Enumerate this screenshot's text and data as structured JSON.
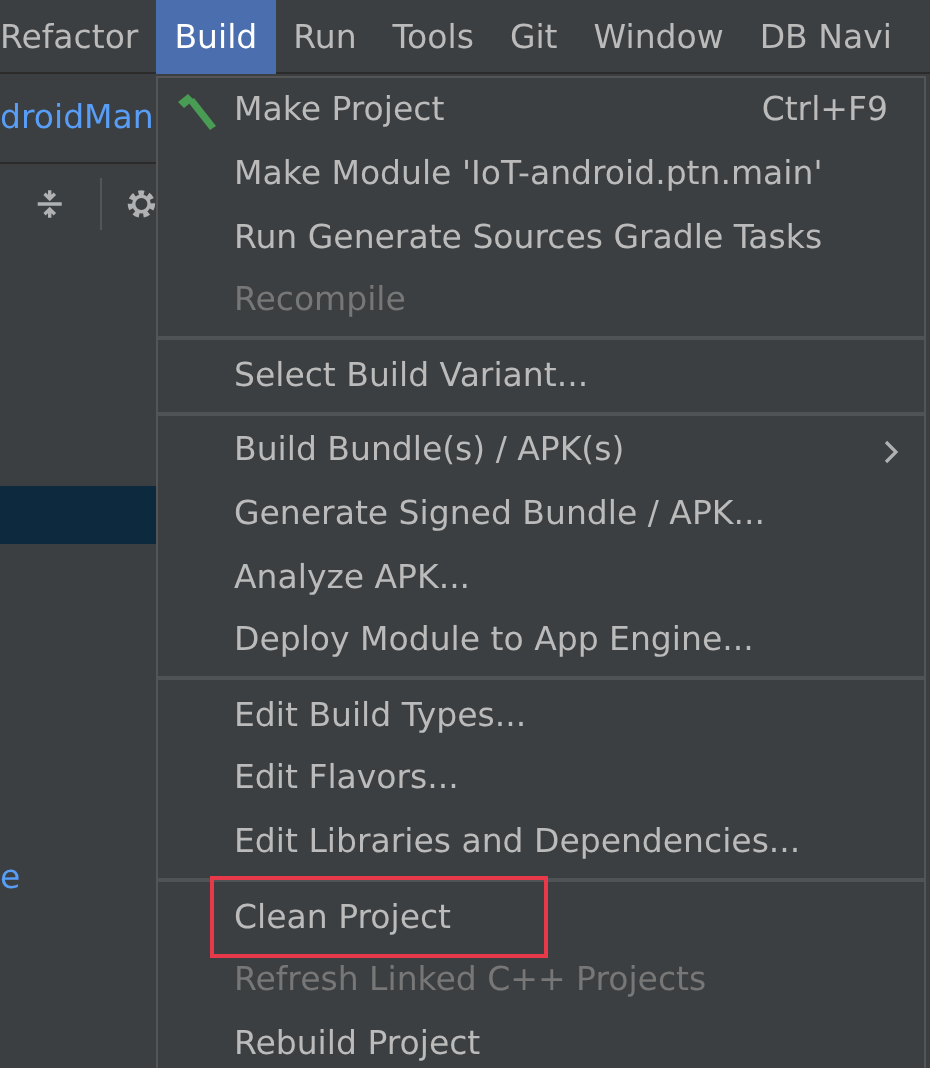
{
  "menu_bar": [
    {
      "label": "Refactor",
      "selected": false
    },
    {
      "label": "Build",
      "selected": true
    },
    {
      "label": "Run",
      "selected": false
    },
    {
      "label": "Tools",
      "selected": false
    },
    {
      "label": "Git",
      "selected": false
    },
    {
      "label": "Window",
      "selected": false
    },
    {
      "label": "DB Navi",
      "selected": false
    }
  ],
  "left_panel": {
    "title": "droidMan",
    "rows": [
      {
        "text": "",
        "selected": true
      },
      {
        "text": "e",
        "selected": false
      }
    ]
  },
  "build_menu": {
    "groups": [
      [
        {
          "label": "Make Project",
          "shortcut": "Ctrl+F9",
          "icon": true,
          "disabled": false
        },
        {
          "label": "Make Module 'IoT-android.ptn.main'",
          "disabled": false
        },
        {
          "label": "Run Generate Sources Gradle Tasks",
          "disabled": false
        },
        {
          "label": "Recompile",
          "disabled": true
        }
      ],
      [
        {
          "label": "Select Build Variant...",
          "disabled": false
        }
      ],
      [
        {
          "label": "Build Bundle(s) / APK(s)",
          "submenu": true,
          "disabled": false
        },
        {
          "label": "Generate Signed Bundle / APK...",
          "disabled": false
        },
        {
          "label": "Analyze APK...",
          "disabled": false
        },
        {
          "label": "Deploy Module to App Engine...",
          "disabled": false
        }
      ],
      [
        {
          "label": "Edit Build Types...",
          "disabled": false
        },
        {
          "label": "Edit Flavors...",
          "disabled": false
        },
        {
          "label": "Edit Libraries and Dependencies...",
          "disabled": false
        }
      ],
      [
        {
          "label": "Clean Project",
          "highlighted": true,
          "disabled": false
        },
        {
          "label": "Refresh Linked C++ Projects",
          "disabled": true
        },
        {
          "label": "Rebuild Project",
          "disabled": false
        }
      ]
    ]
  }
}
